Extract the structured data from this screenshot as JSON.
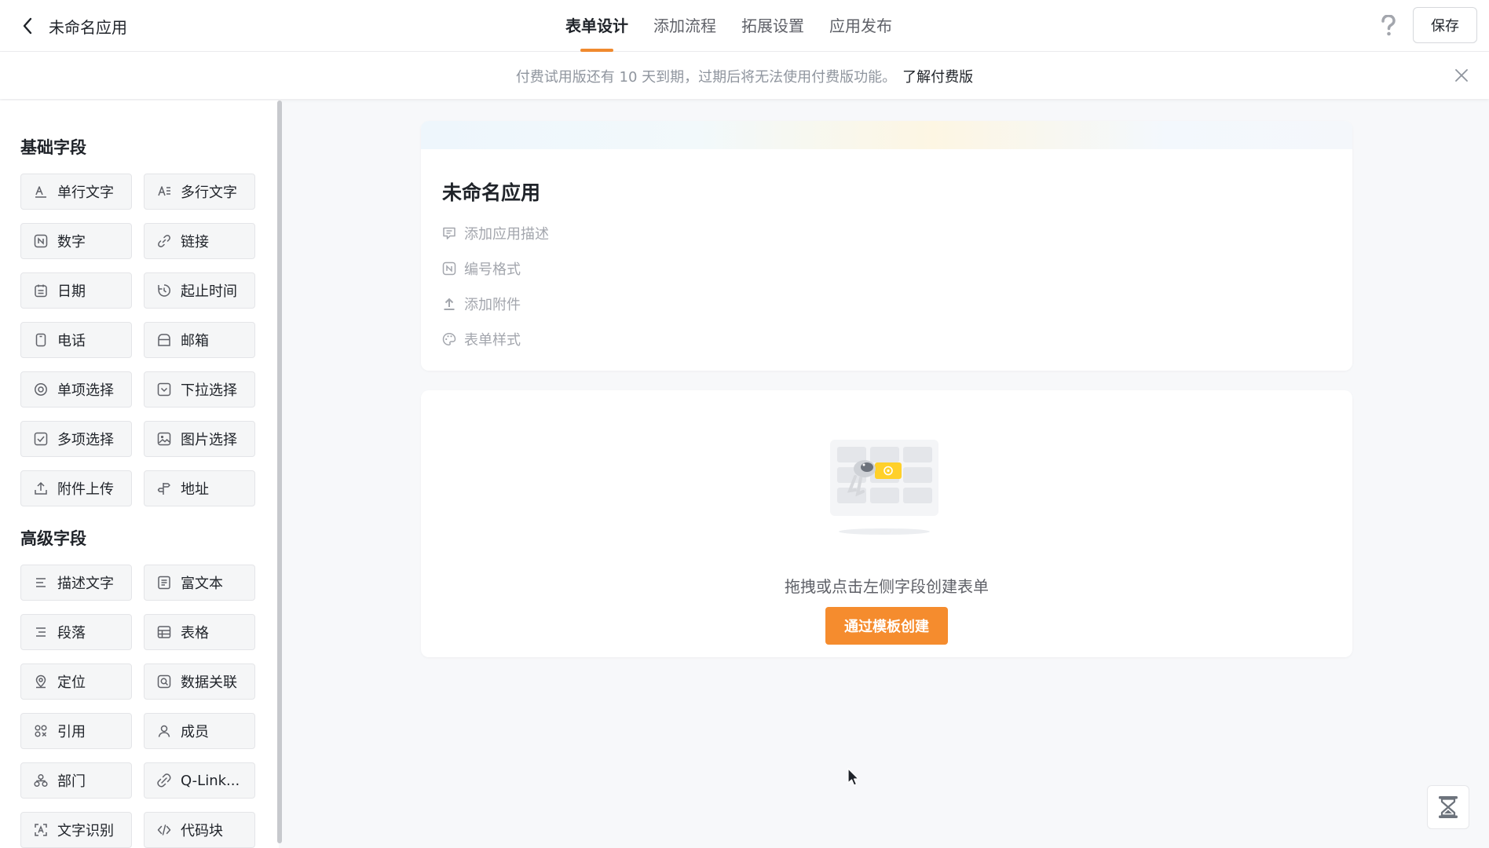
{
  "header": {
    "app_title": "未命名应用",
    "tabs": [
      {
        "label": "表单设计",
        "active": true
      },
      {
        "label": "添加流程",
        "active": false
      },
      {
        "label": "拓展设置",
        "active": false
      },
      {
        "label": "应用发布",
        "active": false
      }
    ],
    "save_label": "保存"
  },
  "notice": {
    "text": "付费试用版还有 10 天到期，过期后将无法使用付费版功能。",
    "link": "了解付费版"
  },
  "sidebar": {
    "basic_title": "基础字段",
    "basic_fields": [
      {
        "label": "单行文字",
        "icon": "single-line-text-icon"
      },
      {
        "label": "多行文字",
        "icon": "multi-line-text-icon"
      },
      {
        "label": "数字",
        "icon": "number-icon"
      },
      {
        "label": "链接",
        "icon": "link-icon"
      },
      {
        "label": "日期",
        "icon": "calendar-icon"
      },
      {
        "label": "起止时间",
        "icon": "time-range-icon"
      },
      {
        "label": "电话",
        "icon": "phone-icon"
      },
      {
        "label": "邮箱",
        "icon": "mailbox-icon"
      },
      {
        "label": "单项选择",
        "icon": "radio-icon"
      },
      {
        "label": "下拉选择",
        "icon": "dropdown-icon"
      },
      {
        "label": "多项选择",
        "icon": "checkbox-icon"
      },
      {
        "label": "图片选择",
        "icon": "image-icon"
      },
      {
        "label": "附件上传",
        "icon": "upload-icon"
      },
      {
        "label": "地址",
        "icon": "address-icon"
      }
    ],
    "advanced_title": "高级字段",
    "advanced_fields": [
      {
        "label": "描述文字",
        "icon": "description-icon"
      },
      {
        "label": "富文本",
        "icon": "rich-text-icon"
      },
      {
        "label": "段落",
        "icon": "paragraph-icon"
      },
      {
        "label": "表格",
        "icon": "table-icon"
      },
      {
        "label": "定位",
        "icon": "location-icon"
      },
      {
        "label": "数据关联",
        "icon": "data-link-icon"
      },
      {
        "label": "引用",
        "icon": "reference-icon"
      },
      {
        "label": "成员",
        "icon": "member-icon"
      },
      {
        "label": "部门",
        "icon": "department-icon"
      },
      {
        "label": "Q-Link...",
        "icon": "q-link-icon"
      },
      {
        "label": "文字识别",
        "icon": "ocr-icon"
      },
      {
        "label": "代码块",
        "icon": "code-icon"
      }
    ]
  },
  "form": {
    "title": "未命名应用",
    "options": [
      {
        "label": "添加应用描述",
        "icon": "comment-icon"
      },
      {
        "label": "编号格式",
        "icon": "number-format-icon"
      },
      {
        "label": "添加附件",
        "icon": "upload-arrow-icon"
      },
      {
        "label": "表单样式",
        "icon": "palette-icon"
      }
    ]
  },
  "empty": {
    "text": "拖拽或点击左侧字段创建表单",
    "button": "通过模板创建"
  },
  "colors": {
    "accent": "#f58c2e",
    "tab_underline": "#f08a2e"
  }
}
